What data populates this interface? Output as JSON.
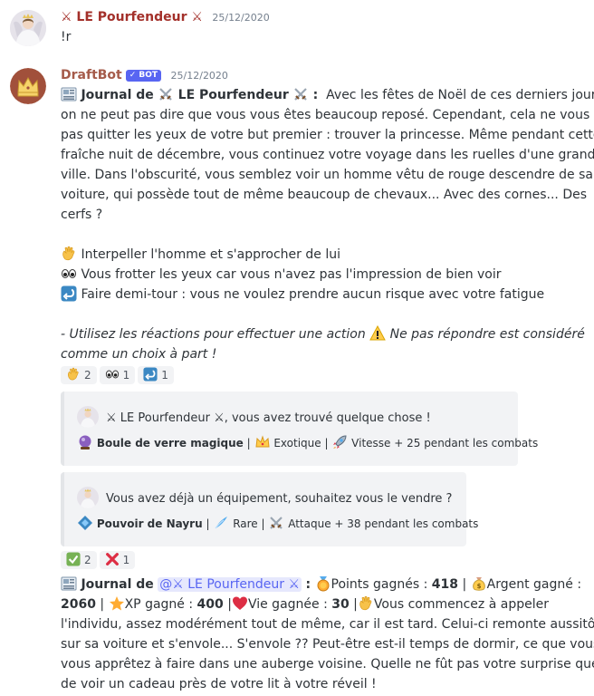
{
  "msg1": {
    "author": "⚔ LE Pourfendeur ⚔",
    "timestamp": "25/12/2020",
    "text": "!r"
  },
  "msg2": {
    "author": "DraftBot",
    "bot_badge": "✓ BOT",
    "timestamp": "25/12/2020",
    "journal_prefix": "Journal de",
    "journal_name": "LE Pourfendeur",
    "journal_colon": ":",
    "story_lines": [
      "Avec les fêtes de Noël de ces derniers jours",
      "on ne peut pas dire que vous vous êtes beaucoup reposé. Cependant, cela ne vous fait",
      "pas quitter les yeux de votre but premier : trouver la princesse. Même pendant cette",
      "fraîche nuit de décembre, vous continuez votre voyage dans les ruelles d'une grande",
      "ville. Dans l'obscurité, vous semblez voir un homme vêtu de rouge descendre de sa",
      "voiture, qui possède tout de même beaucoup de chevaux... Avec des cornes... Des",
      "cerfs ?"
    ],
    "choices": [
      "Interpeller l'homme et s'approcher de lui",
      "Vous frotter les yeux car vous n'avez pas l'impression de bien voir",
      "Faire demi-tour : vous ne voulez prendre aucun risque avec votre fatigue"
    ],
    "hint_part1": "- Utilisez les réactions pour effectuer une action",
    "hint_part2": "Ne pas répondre est considéré",
    "hint_line2": "comme un choix à part !",
    "reactions": [
      "2",
      "1",
      "1"
    ]
  },
  "embed1": {
    "title": "⚔ LE Pourfendeur ⚔, vous avez trouvé quelque chose !",
    "item_name": "Boule de verre magique",
    "sep": "|",
    "rarity": "Exotique",
    "effect": "Vitesse + 25 pendant les combats"
  },
  "embed2": {
    "title": "Vous avez déjà un équipement, souhaitez vous le vendre ?",
    "item_name": "Pouvoir de Nayru",
    "sep": "|",
    "rarity": "Rare",
    "effect": "Attaque + 38 pendant les combats"
  },
  "reactions2": [
    "2",
    "1"
  ],
  "msg3": {
    "journal_prefix": "Journal de",
    "mention": "@⚔ LE Pourfendeur ⚔",
    "colon": ":",
    "points_label": "Points gagnés :",
    "points": "418",
    "money_label": "Argent gagné :",
    "money": "2060",
    "xp_label": "XP gagné :",
    "xp": "400",
    "life_label": "Vie gagnée :",
    "life": "30",
    "text_start": "Vous commencez à appeler",
    "lines": [
      "l'individu, assez modérément tout de même, car il est tard. Celui-ci remonte aussitôt",
      "sur sa voiture et s'envole... S'envole ?? Peut-être est-il temps de dormir, ce que vous",
      "vous apprêtez à faire dans une auberge voisine. Quelle ne fût pas votre surprise que",
      "de voir un cadeau près de votre lit à votre réveil !"
    ]
  }
}
